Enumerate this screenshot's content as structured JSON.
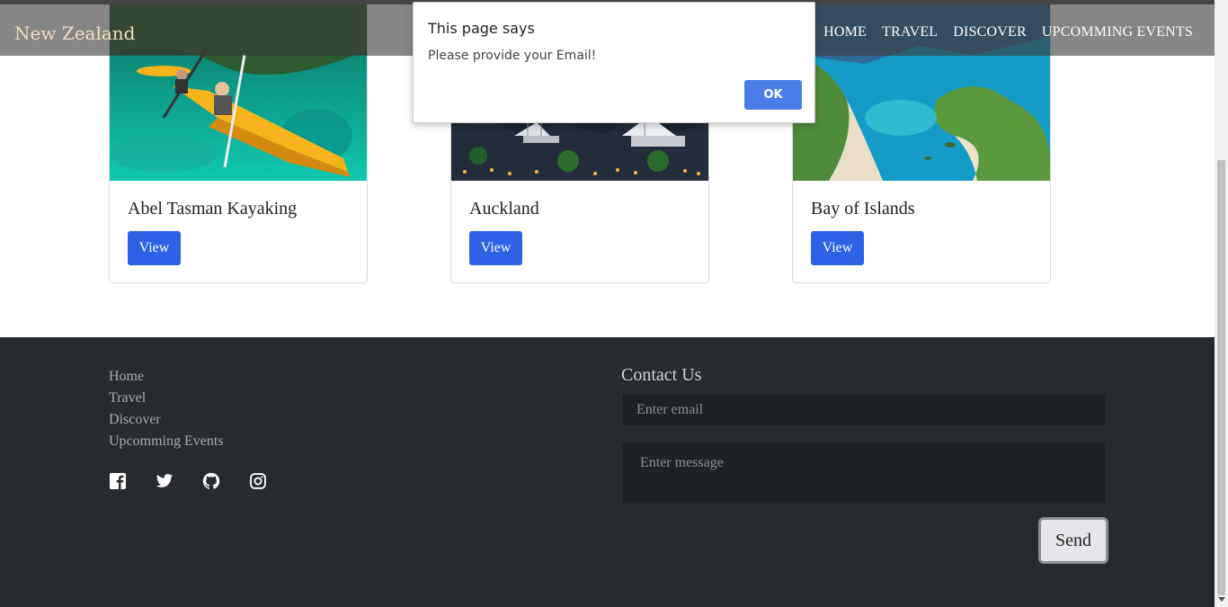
{
  "navbar": {
    "brand": "New Zealand",
    "links": [
      "HOME",
      "TRAVEL",
      "DISCOVER",
      "UPCOMMING EVENTS"
    ]
  },
  "cards": [
    {
      "title": "Abel Tasman Kayaking",
      "button": "View"
    },
    {
      "title": "Auckland",
      "button": "View"
    },
    {
      "title": "Bay of Islands",
      "button": "View"
    }
  ],
  "footer": {
    "links": [
      "Home",
      "Travel",
      "Discover",
      "Upcomming Events"
    ],
    "socials": [
      "facebook-icon",
      "twitter-icon",
      "github-icon",
      "instagram-icon"
    ],
    "contact_title": "Contact Us",
    "email_placeholder": "Enter email",
    "message_placeholder": "Enter message",
    "send_label": "Send"
  },
  "dialog": {
    "title": "This page says",
    "message": "Please provide your Email!",
    "ok_label": "OK"
  },
  "colors": {
    "button_blue": "#2e62e6",
    "footer_bg": "#272b2f",
    "brand_color": "#f3dfc0",
    "dialog_ok": "#4b7ee8"
  }
}
